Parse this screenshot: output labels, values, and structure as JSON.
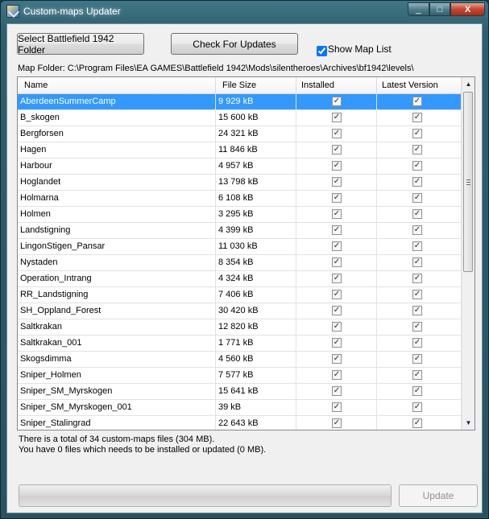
{
  "window": {
    "title": "Custom-maps Updater",
    "minimize_glyph": "_",
    "maximize_glyph": "□",
    "close_glyph": "X"
  },
  "toolbar": {
    "select_folder_label": "Select Battlefield 1942 Folder",
    "check_updates_label": "Check For Updates",
    "show_map_list_label": "Show Map List",
    "show_map_list_checked": true
  },
  "map_folder": "Map Folder: C:\\Program Files\\EA GAMES\\Battlefield 1942\\Mods\\silentheroes\\Archives\\bf1942\\levels\\",
  "table": {
    "columns": [
      "Name",
      "File Size",
      "Installed",
      "Latest Version"
    ],
    "check_glyph": "✓",
    "rows": [
      {
        "name": "AberdeenSummerCamp",
        "size": "9 929 kB",
        "installed": true,
        "latest": true,
        "selected": true
      },
      {
        "name": "B_skogen",
        "size": "15 600 kB",
        "installed": true,
        "latest": true
      },
      {
        "name": "Bergforsen",
        "size": "24 321 kB",
        "installed": true,
        "latest": true
      },
      {
        "name": "Hagen",
        "size": "11 846 kB",
        "installed": true,
        "latest": true
      },
      {
        "name": "Harbour",
        "size": "4 957 kB",
        "installed": true,
        "latest": true
      },
      {
        "name": "Hoglandet",
        "size": "13 798 kB",
        "installed": true,
        "latest": true
      },
      {
        "name": "Holmarna",
        "size": "6 108 kB",
        "installed": true,
        "latest": true
      },
      {
        "name": "Holmen",
        "size": "3 295 kB",
        "installed": true,
        "latest": true
      },
      {
        "name": "Landstigning",
        "size": "4 399 kB",
        "installed": true,
        "latest": true
      },
      {
        "name": "LingonStigen_Pansar",
        "size": "11 030 kB",
        "installed": true,
        "latest": true
      },
      {
        "name": "Nystaden",
        "size": "8 354 kB",
        "installed": true,
        "latest": true
      },
      {
        "name": "Operation_Intrang",
        "size": "4 324 kB",
        "installed": true,
        "latest": true
      },
      {
        "name": "RR_Landstigning",
        "size": "7 406 kB",
        "installed": true,
        "latest": true
      },
      {
        "name": "SH_Oppland_Forest",
        "size": "30 420 kB",
        "installed": true,
        "latest": true
      },
      {
        "name": "Saltkrakan",
        "size": "12 820 kB",
        "installed": true,
        "latest": true
      },
      {
        "name": "Saltkrakan_001",
        "size": "1 771 kB",
        "installed": true,
        "latest": true
      },
      {
        "name": "Skogsdimma",
        "size": "4 560 kB",
        "installed": true,
        "latest": true
      },
      {
        "name": "Sniper_Holmen",
        "size": "7 577 kB",
        "installed": true,
        "latest": true
      },
      {
        "name": "Sniper_SM_Myrskogen",
        "size": "15 641 kB",
        "installed": true,
        "latest": true
      },
      {
        "name": "Sniper_SM_Myrskogen_001",
        "size": "39 kB",
        "installed": true,
        "latest": true
      },
      {
        "name": "Sniper_Stalingrad",
        "size": "22 643 kB",
        "installed": true,
        "latest": true
      }
    ]
  },
  "scrollbar": {
    "up_glyph": "▲",
    "down_glyph": "▼"
  },
  "status": {
    "line1": "There is a total of 34 custom-maps files (304 MB).",
    "line2": "You have 0 files which needs to be installed or updated (0 MB)."
  },
  "progress": {
    "value": 0
  },
  "update_label": "Update",
  "colors": {
    "selection": "#3399ff",
    "title_text": "#ffffff",
    "disabled_text": "#8e8e8e"
  }
}
